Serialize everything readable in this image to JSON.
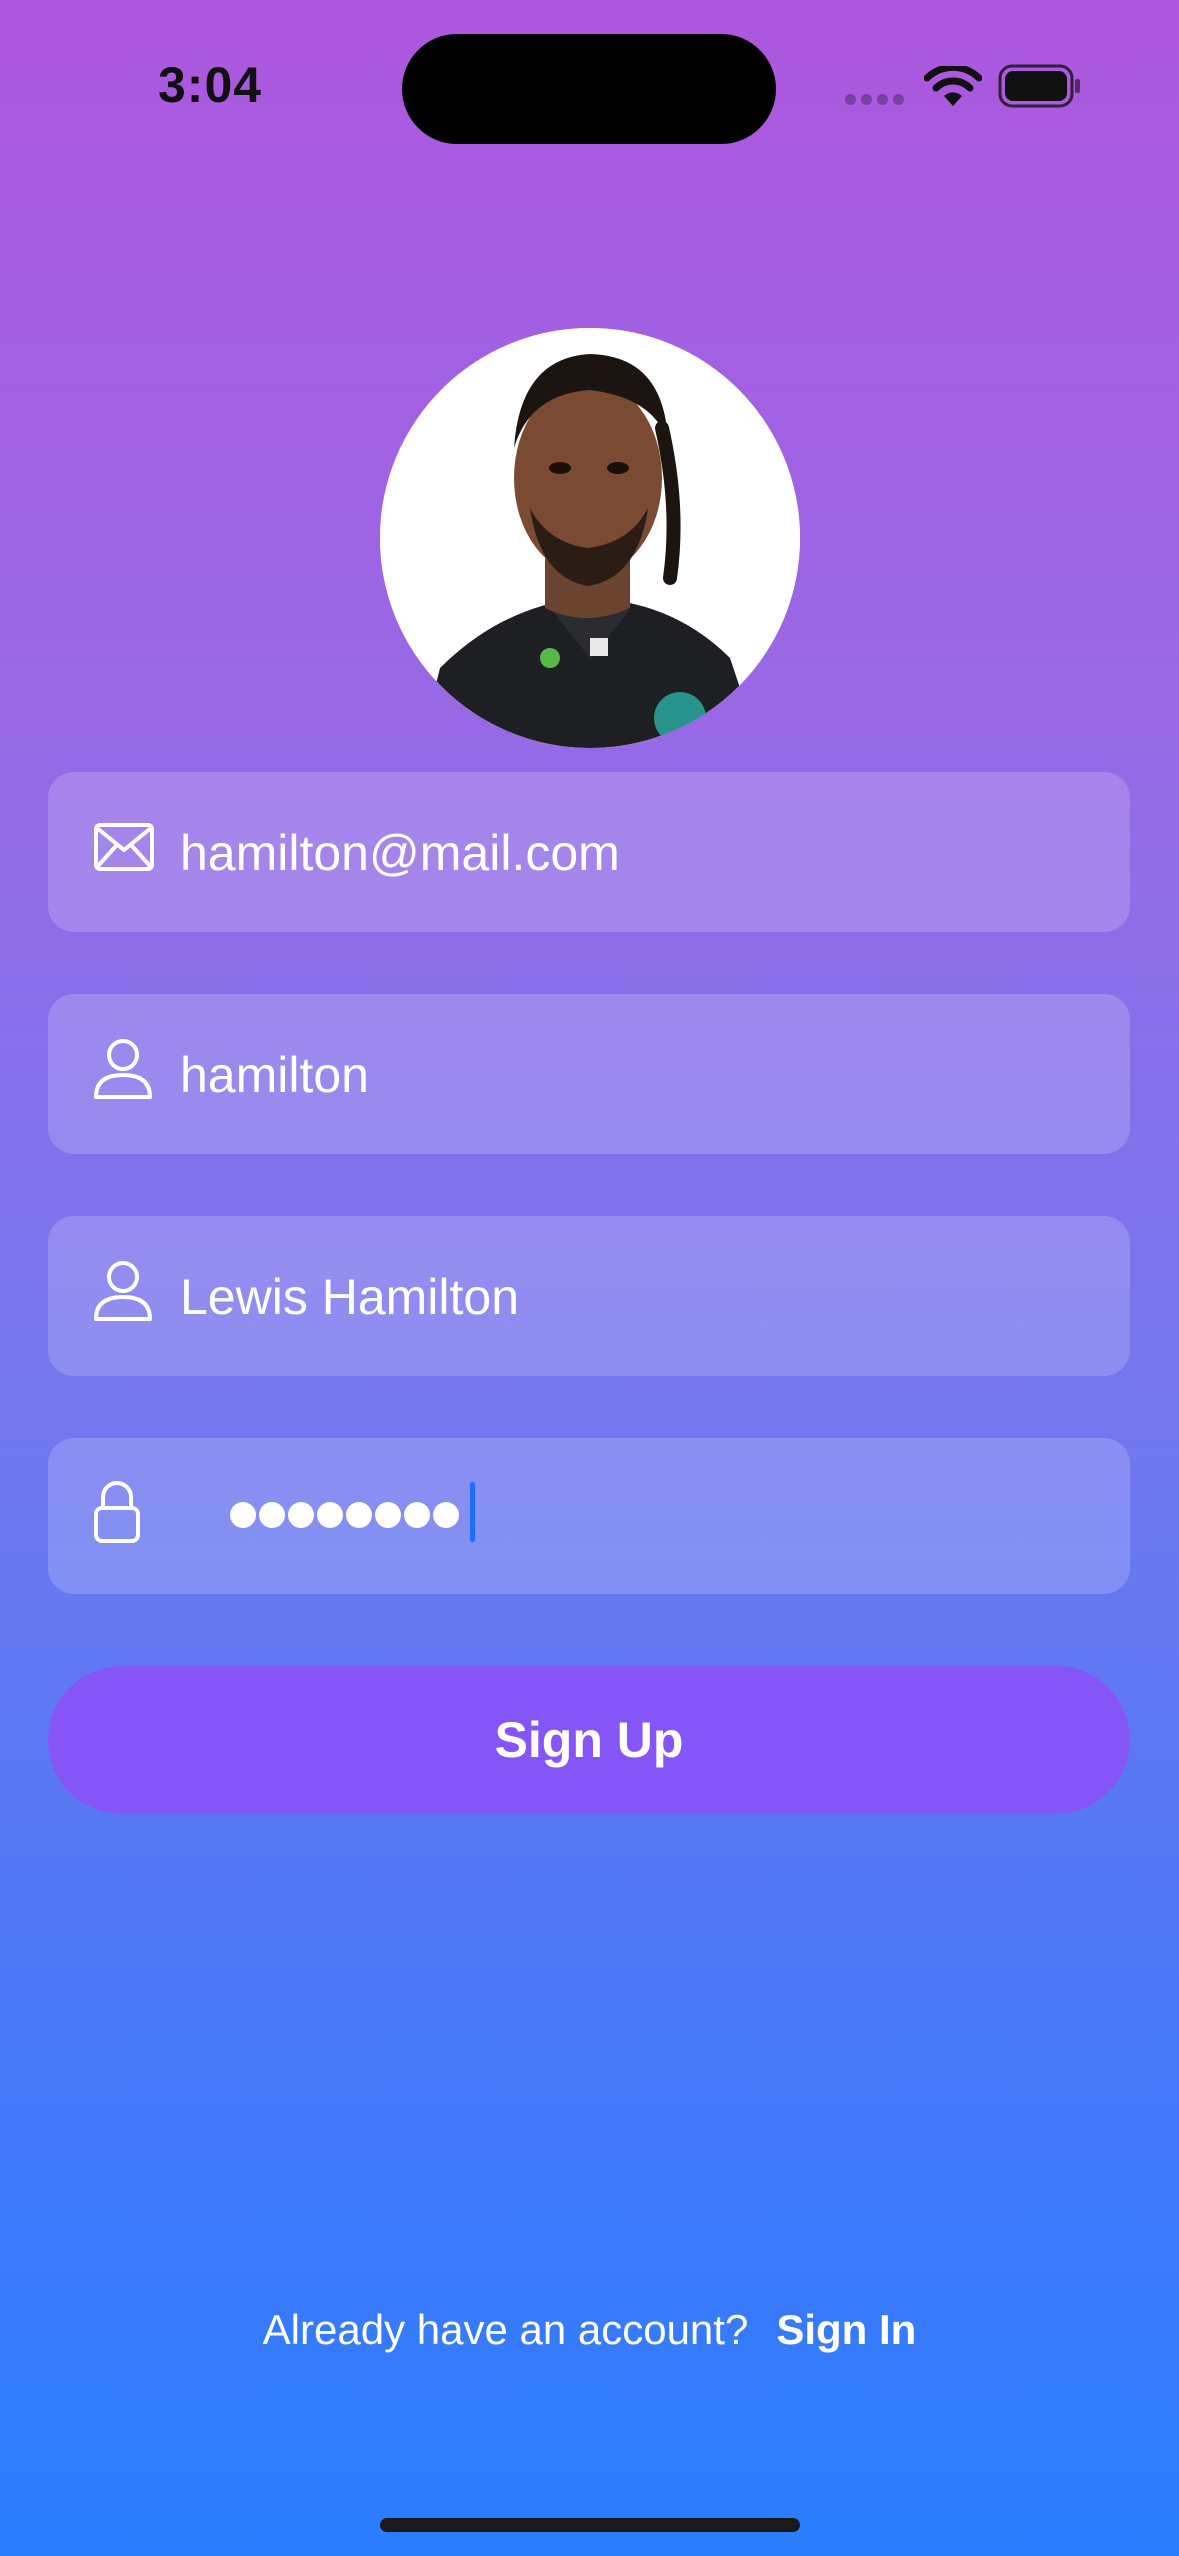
{
  "status_bar": {
    "time": "3:04"
  },
  "profile": {
    "avatar_alt": "hamilton"
  },
  "form": {
    "email": {
      "value": "hamilton@mail.com",
      "icon": "envelope-icon"
    },
    "username": {
      "value": "hamilton",
      "icon": "person-icon"
    },
    "full_name": {
      "value": "Lewis Hamilton",
      "icon": "person-icon"
    },
    "password": {
      "masked_length": 8,
      "icon": "lock-icon"
    }
  },
  "actions": {
    "signup_label": "Sign Up"
  },
  "footer": {
    "prompt": "Already have an account?",
    "signin_label": "Sign In"
  },
  "colors": {
    "gradient_top": "#ad57de",
    "gradient_bottom": "#2a7dff",
    "button": "#8655f7",
    "caret": "#1f6dff"
  }
}
